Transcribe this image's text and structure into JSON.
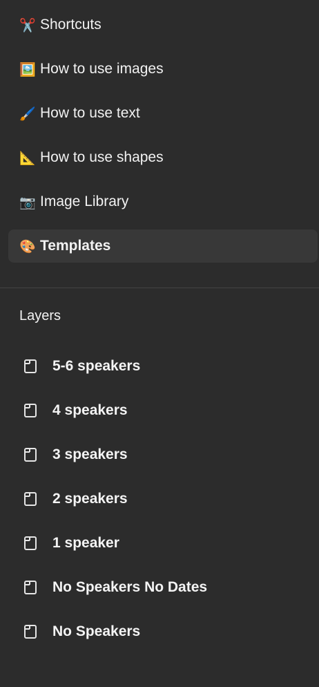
{
  "pages": [
    {
      "emoji": "✂️",
      "icon": "scissors-icon",
      "label": "Shortcuts",
      "active": false
    },
    {
      "emoji": "🖼️",
      "icon": "picture-icon",
      "label": "How to use images",
      "active": false
    },
    {
      "emoji": "🖌️",
      "icon": "paintbrush-icon",
      "label": "How to use text",
      "active": false
    },
    {
      "emoji": "📐",
      "icon": "triangle-ruler-icon",
      "label": "How to use shapes",
      "active": false
    },
    {
      "emoji": "📷",
      "icon": "camera-icon",
      "label": "Image Library",
      "active": false
    },
    {
      "emoji": "🎨",
      "icon": "palette-icon",
      "label": "Templates",
      "active": true
    }
  ],
  "layers_title": "Layers",
  "layers": [
    {
      "label": "5-6 speakers"
    },
    {
      "label": "4 speakers"
    },
    {
      "label": "3 speakers"
    },
    {
      "label": "2 speakers"
    },
    {
      "label": "1 speaker"
    },
    {
      "label": "No Speakers No Dates"
    },
    {
      "label": "No Speakers"
    }
  ],
  "colors": {
    "background": "#2c2c2c",
    "active_item": "#383838",
    "divider": "#444444",
    "text": "#f2f2f2"
  }
}
